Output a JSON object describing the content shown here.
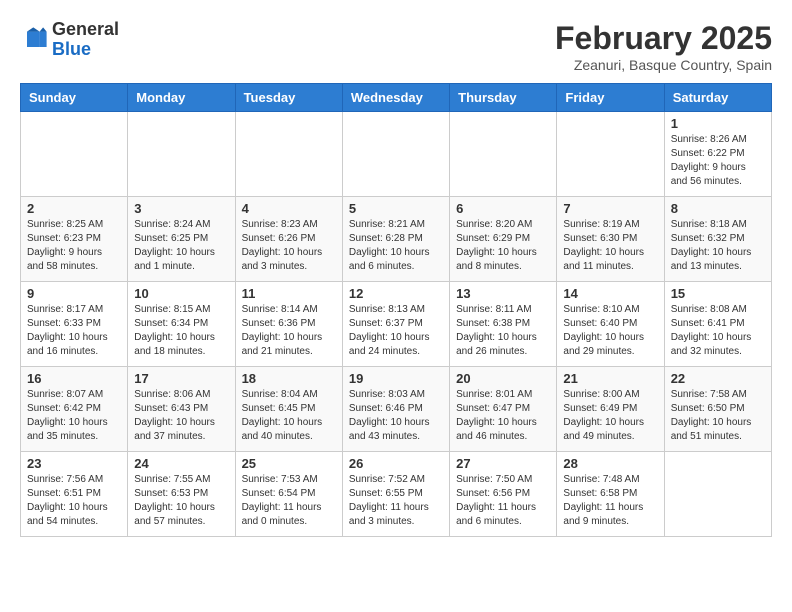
{
  "header": {
    "logo_general": "General",
    "logo_blue": "Blue",
    "month_title": "February 2025",
    "subtitle": "Zeanuri, Basque Country, Spain"
  },
  "weekdays": [
    "Sunday",
    "Monday",
    "Tuesday",
    "Wednesday",
    "Thursday",
    "Friday",
    "Saturday"
  ],
  "weeks": [
    [
      {
        "day": "",
        "info": ""
      },
      {
        "day": "",
        "info": ""
      },
      {
        "day": "",
        "info": ""
      },
      {
        "day": "",
        "info": ""
      },
      {
        "day": "",
        "info": ""
      },
      {
        "day": "",
        "info": ""
      },
      {
        "day": "1",
        "info": "Sunrise: 8:26 AM\nSunset: 6:22 PM\nDaylight: 9 hours and 56 minutes."
      }
    ],
    [
      {
        "day": "2",
        "info": "Sunrise: 8:25 AM\nSunset: 6:23 PM\nDaylight: 9 hours and 58 minutes."
      },
      {
        "day": "3",
        "info": "Sunrise: 8:24 AM\nSunset: 6:25 PM\nDaylight: 10 hours and 1 minute."
      },
      {
        "day": "4",
        "info": "Sunrise: 8:23 AM\nSunset: 6:26 PM\nDaylight: 10 hours and 3 minutes."
      },
      {
        "day": "5",
        "info": "Sunrise: 8:21 AM\nSunset: 6:28 PM\nDaylight: 10 hours and 6 minutes."
      },
      {
        "day": "6",
        "info": "Sunrise: 8:20 AM\nSunset: 6:29 PM\nDaylight: 10 hours and 8 minutes."
      },
      {
        "day": "7",
        "info": "Sunrise: 8:19 AM\nSunset: 6:30 PM\nDaylight: 10 hours and 11 minutes."
      },
      {
        "day": "8",
        "info": "Sunrise: 8:18 AM\nSunset: 6:32 PM\nDaylight: 10 hours and 13 minutes."
      }
    ],
    [
      {
        "day": "9",
        "info": "Sunrise: 8:17 AM\nSunset: 6:33 PM\nDaylight: 10 hours and 16 minutes."
      },
      {
        "day": "10",
        "info": "Sunrise: 8:15 AM\nSunset: 6:34 PM\nDaylight: 10 hours and 18 minutes."
      },
      {
        "day": "11",
        "info": "Sunrise: 8:14 AM\nSunset: 6:36 PM\nDaylight: 10 hours and 21 minutes."
      },
      {
        "day": "12",
        "info": "Sunrise: 8:13 AM\nSunset: 6:37 PM\nDaylight: 10 hours and 24 minutes."
      },
      {
        "day": "13",
        "info": "Sunrise: 8:11 AM\nSunset: 6:38 PM\nDaylight: 10 hours and 26 minutes."
      },
      {
        "day": "14",
        "info": "Sunrise: 8:10 AM\nSunset: 6:40 PM\nDaylight: 10 hours and 29 minutes."
      },
      {
        "day": "15",
        "info": "Sunrise: 8:08 AM\nSunset: 6:41 PM\nDaylight: 10 hours and 32 minutes."
      }
    ],
    [
      {
        "day": "16",
        "info": "Sunrise: 8:07 AM\nSunset: 6:42 PM\nDaylight: 10 hours and 35 minutes."
      },
      {
        "day": "17",
        "info": "Sunrise: 8:06 AM\nSunset: 6:43 PM\nDaylight: 10 hours and 37 minutes."
      },
      {
        "day": "18",
        "info": "Sunrise: 8:04 AM\nSunset: 6:45 PM\nDaylight: 10 hours and 40 minutes."
      },
      {
        "day": "19",
        "info": "Sunrise: 8:03 AM\nSunset: 6:46 PM\nDaylight: 10 hours and 43 minutes."
      },
      {
        "day": "20",
        "info": "Sunrise: 8:01 AM\nSunset: 6:47 PM\nDaylight: 10 hours and 46 minutes."
      },
      {
        "day": "21",
        "info": "Sunrise: 8:00 AM\nSunset: 6:49 PM\nDaylight: 10 hours and 49 minutes."
      },
      {
        "day": "22",
        "info": "Sunrise: 7:58 AM\nSunset: 6:50 PM\nDaylight: 10 hours and 51 minutes."
      }
    ],
    [
      {
        "day": "23",
        "info": "Sunrise: 7:56 AM\nSunset: 6:51 PM\nDaylight: 10 hours and 54 minutes."
      },
      {
        "day": "24",
        "info": "Sunrise: 7:55 AM\nSunset: 6:53 PM\nDaylight: 10 hours and 57 minutes."
      },
      {
        "day": "25",
        "info": "Sunrise: 7:53 AM\nSunset: 6:54 PM\nDaylight: 11 hours and 0 minutes."
      },
      {
        "day": "26",
        "info": "Sunrise: 7:52 AM\nSunset: 6:55 PM\nDaylight: 11 hours and 3 minutes."
      },
      {
        "day": "27",
        "info": "Sunrise: 7:50 AM\nSunset: 6:56 PM\nDaylight: 11 hours and 6 minutes."
      },
      {
        "day": "28",
        "info": "Sunrise: 7:48 AM\nSunset: 6:58 PM\nDaylight: 11 hours and 9 minutes."
      },
      {
        "day": "",
        "info": ""
      }
    ]
  ]
}
